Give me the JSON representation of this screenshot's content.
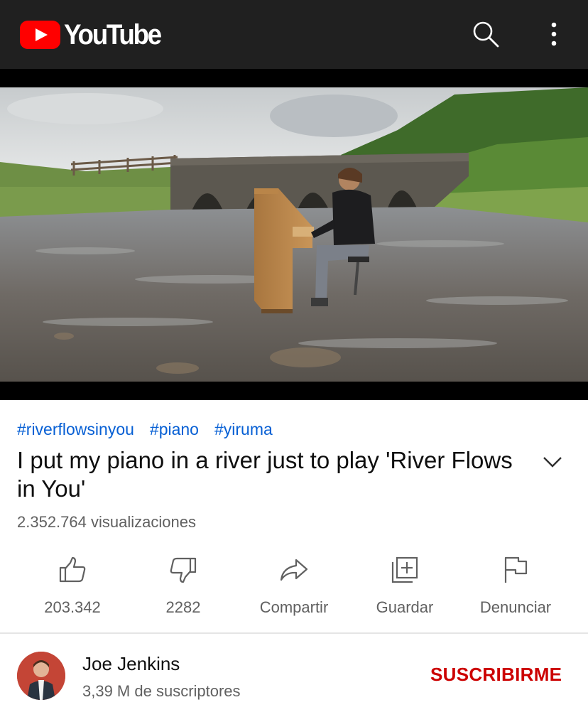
{
  "app": {
    "logo_text": "YouTube"
  },
  "appbar": {
    "search_icon": "search-icon",
    "more_icon": "more-vertical-icon"
  },
  "video": {
    "hashtags": [
      "#riverflowsinyou",
      "#piano",
      "#yiruma"
    ],
    "title": "I put my piano in a river just to play 'River Flows in You'",
    "views": "2.352.764 visualizaciones"
  },
  "actions": {
    "like": {
      "icon": "thumbs-up-icon",
      "label": "203.342"
    },
    "dislike": {
      "icon": "thumbs-down-icon",
      "label": "2282"
    },
    "share": {
      "icon": "share-icon",
      "label": "Compartir"
    },
    "save": {
      "icon": "add-to-playlist-icon",
      "label": "Guardar"
    },
    "report": {
      "icon": "flag-icon",
      "label": "Denunciar"
    }
  },
  "channel": {
    "name": "Joe Jenkins",
    "subscribers": "3,39 M de suscriptores",
    "subscribe_label": "SUSCRIBIRME"
  },
  "colors": {
    "appbar_bg": "#202020",
    "brand_red": "#ff0000",
    "hashtag_blue": "#065fd4",
    "subscribe_red": "#cc0000",
    "secondary_text": "#606060"
  }
}
